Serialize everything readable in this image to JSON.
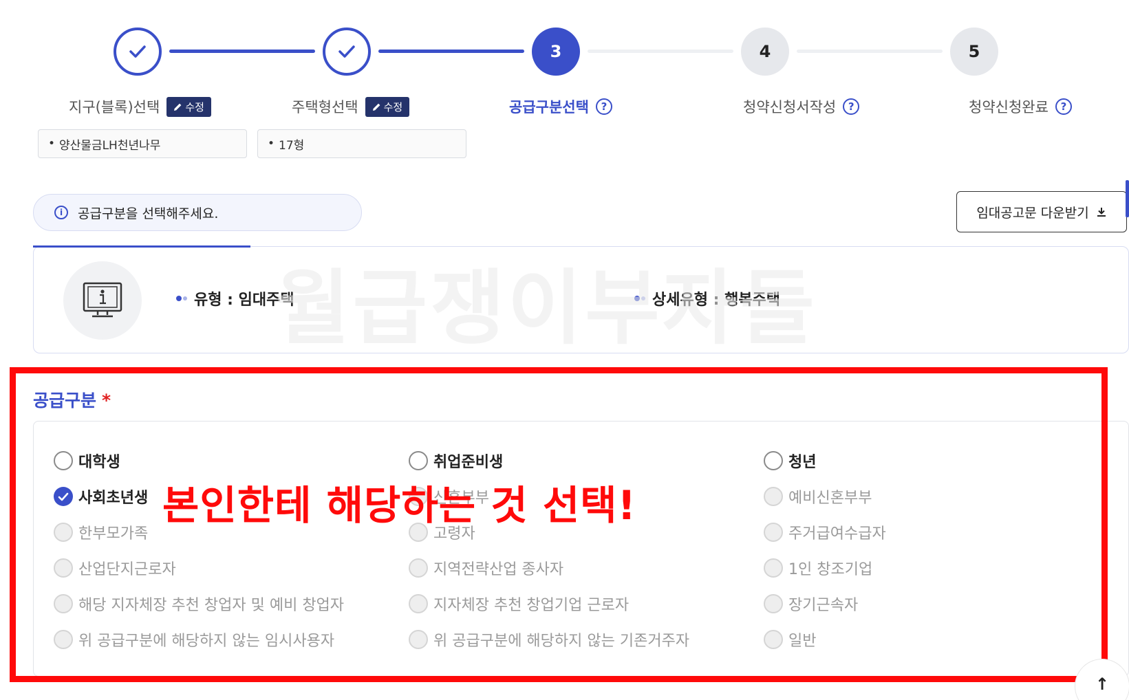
{
  "stepper": {
    "steps": [
      {
        "label": "지구(블록)선택",
        "state": "done",
        "badge": "수정",
        "value": "양산물금LH천년나무"
      },
      {
        "label": "주택형선택",
        "state": "done",
        "badge": "수정",
        "value": "17형"
      },
      {
        "label": "공급구분선택",
        "state": "current",
        "number": "3"
      },
      {
        "label": "청약신청서작성",
        "state": "todo",
        "number": "4"
      },
      {
        "label": "청약신청완료",
        "state": "todo",
        "number": "5"
      }
    ],
    "help_glyph": "?",
    "bullet": "•"
  },
  "notice": {
    "text": "공급구분을 선택해주세요.",
    "icon": "info-icon",
    "icon_glyph": "i"
  },
  "download": {
    "label": "임대공고문 다운받기",
    "icon": "download-icon"
  },
  "type_card": {
    "icon": "kiosk-info-icon",
    "type": "유형 : 임대주택",
    "subtype": "상세유형 : 행복주택"
  },
  "watermark": "월급쟁이부자들",
  "supply": {
    "title": "공급구분",
    "required_mark": "*",
    "options": [
      {
        "label": "대학생",
        "state": "enabled"
      },
      {
        "label": "취업준비생",
        "state": "enabled"
      },
      {
        "label": "청년",
        "state": "enabled"
      },
      {
        "label": "사회초년생",
        "state": "checked"
      },
      {
        "label": "신혼부부",
        "state": "disabled"
      },
      {
        "label": "예비신혼부부",
        "state": "disabled"
      },
      {
        "label": "한부모가족",
        "state": "disabled"
      },
      {
        "label": "고령자",
        "state": "disabled"
      },
      {
        "label": "주거급여수급자",
        "state": "disabled"
      },
      {
        "label": "산업단지근로자",
        "state": "disabled"
      },
      {
        "label": "지역전략산업 종사자",
        "state": "disabled"
      },
      {
        "label": "1인 창조기업",
        "state": "disabled"
      },
      {
        "label": "해당 지자체장 추천 창업자 및 예비 창업자",
        "state": "disabled"
      },
      {
        "label": "지자체장 추천 창업기업 근로자",
        "state": "disabled"
      },
      {
        "label": "장기근속자",
        "state": "disabled"
      },
      {
        "label": "위 공급구분에 해당하지 않는 임시사용자",
        "state": "disabled"
      },
      {
        "label": "위 공급구분에 해당하지 않는 기존거주자",
        "state": "disabled"
      },
      {
        "label": "일반",
        "state": "disabled"
      }
    ]
  },
  "annotation": {
    "text": "본인한테 해당하는 것 선택!",
    "color": "#ff0a0a"
  },
  "scroll_top": {
    "glyph": "↑",
    "icon": "arrow-up-icon"
  },
  "colors": {
    "accent": "#3a4fc9",
    "annotation": "#ff0a0a",
    "edit_badge": "#25336b"
  }
}
